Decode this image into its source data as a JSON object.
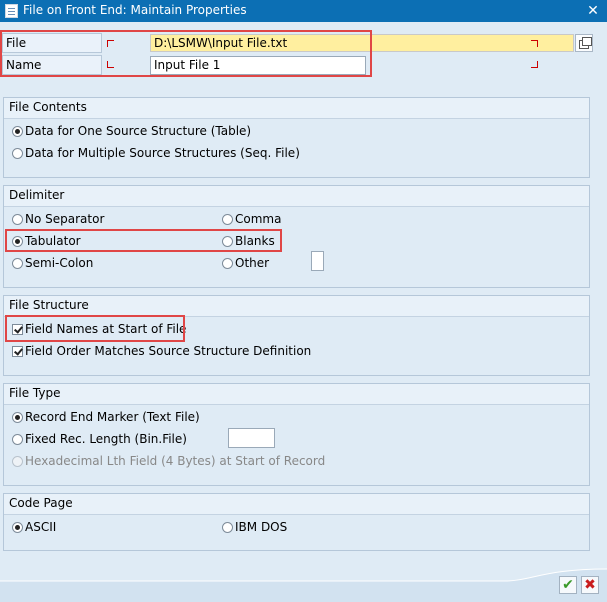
{
  "window": {
    "title": "File on Front End: Maintain Properties",
    "close_glyph": "✕"
  },
  "file_field": {
    "label": "File",
    "value": "D:\\LSMW\\Input File.txt"
  },
  "name_field": {
    "label": "Name",
    "value": "Input File 1"
  },
  "file_contents": {
    "heading": "File Contents",
    "options": [
      {
        "label": "Data for One Source Structure (Table)",
        "selected": true
      },
      {
        "label": "Data for Multiple Source Structures (Seq. File)",
        "selected": false
      }
    ]
  },
  "delimiter": {
    "heading": "Delimiter",
    "options": [
      {
        "label": "No Separator",
        "selected": false
      },
      {
        "label": "Comma",
        "selected": false
      },
      {
        "label": "Tabulator",
        "selected": true
      },
      {
        "label": "Blanks",
        "selected": false
      },
      {
        "label": "Semi-Colon",
        "selected": false
      },
      {
        "label": "Other",
        "selected": false
      }
    ],
    "other_value": ""
  },
  "file_structure": {
    "heading": "File Structure",
    "options": [
      {
        "label": "Field Names at Start of File",
        "checked": true
      },
      {
        "label": "Field Order Matches Source Structure Definition",
        "checked": true
      }
    ]
  },
  "file_type": {
    "heading": "File Type",
    "options": [
      {
        "label": "Record End Marker (Text File)",
        "selected": true
      },
      {
        "label": "Fixed Rec. Length (Bin.File)",
        "selected": false
      },
      {
        "label": "Hexadecimal Lth Field (4 Bytes) at Start of Record",
        "selected": false,
        "disabled": true
      }
    ],
    "fixed_length_value": ""
  },
  "code_page": {
    "heading": "Code Page",
    "options": [
      {
        "label": "ASCII",
        "selected": true
      },
      {
        "label": "IBM DOS",
        "selected": false
      }
    ]
  },
  "footer": {
    "ok_glyph": "✔",
    "cancel_glyph": "✖"
  },
  "colors": {
    "titlebar": "#0c6fb4",
    "background": "#dfebf5",
    "highlight": "#e04646",
    "required_input": "#ffef9f"
  }
}
